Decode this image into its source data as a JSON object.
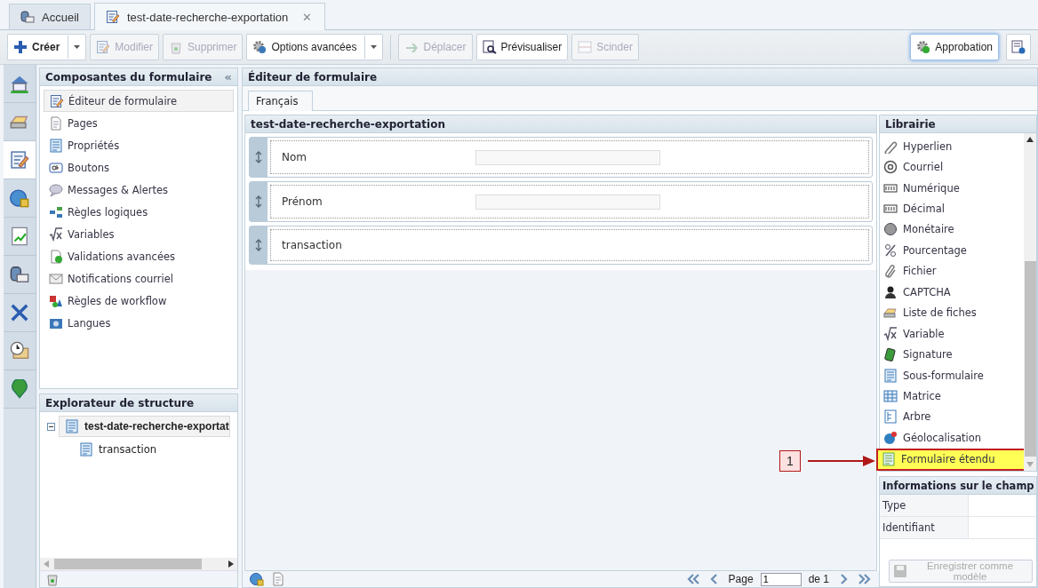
{
  "tabs": [
    {
      "label": "Accueil",
      "selected": false
    },
    {
      "label": "test-date-recherche-exportation",
      "selected": true,
      "close": "✕"
    }
  ],
  "toolbar": {
    "left": [
      {
        "label": "Créer",
        "disabled": false,
        "dropdown": true
      },
      {
        "label": "Modifier",
        "disabled": true,
        "dropdown": false
      },
      {
        "label": "Supprimer",
        "disabled": true,
        "dropdown": false
      },
      {
        "label": "Options avancées",
        "disabled": false,
        "dropdown": true
      },
      {
        "label": "Déplacer",
        "disabled": true,
        "dropdown": false
      },
      {
        "label": "Prévisualiser",
        "disabled": false,
        "dropdown": false
      },
      {
        "label": "Scinder",
        "disabled": true,
        "dropdown": false
      }
    ],
    "right": [
      {
        "label": "Approbation",
        "selected": true
      }
    ]
  },
  "rail": [
    {
      "selected": false
    },
    {
      "selected": false
    },
    {
      "selected": true
    },
    {
      "selected": false
    },
    {
      "selected": false
    },
    {
      "selected": false
    },
    {
      "selected": false
    },
    {
      "selected": false
    },
    {
      "selected": false
    }
  ],
  "components": {
    "title": "Composantes du formulaire",
    "collapse": "«",
    "items": [
      {
        "label": "Éditeur de formulaire",
        "selected": true
      },
      {
        "label": "Pages",
        "selected": false
      },
      {
        "label": "Propriétés",
        "selected": false
      },
      {
        "label": "Boutons",
        "selected": false
      },
      {
        "label": "Messages & Alertes",
        "selected": false
      },
      {
        "label": "Règles logiques",
        "selected": false
      },
      {
        "label": "Variables",
        "selected": false
      },
      {
        "label": "Validations avancées",
        "selected": false
      },
      {
        "label": "Notifications courriel",
        "selected": false
      },
      {
        "label": "Règles de workflow",
        "selected": false
      },
      {
        "label": "Langues",
        "selected": false
      }
    ]
  },
  "explorer": {
    "title": "Explorateur de structure",
    "tree": [
      {
        "label": "test-date-recherche-exportat",
        "expanded": true,
        "selected": true,
        "children": [
          {
            "label": "transaction"
          }
        ]
      }
    ]
  },
  "editor": {
    "title": "Éditeur de formulaire",
    "languages": [
      {
        "label": "Français",
        "selected": true
      }
    ],
    "form": {
      "title": "test-date-recherche-exportation",
      "fields": [
        {
          "kind": "text",
          "label": "Nom"
        },
        {
          "kind": "text",
          "label": "Prénom"
        },
        {
          "kind": "section",
          "label": "transaction"
        }
      ]
    },
    "pager": {
      "label": "Page",
      "value": "1",
      "total": "de 1"
    }
  },
  "library": {
    "title": "Librairie",
    "items": [
      {
        "label": "Hyperlien",
        "highlighted": false
      },
      {
        "label": "Courriel",
        "highlighted": false
      },
      {
        "label": "Numérique",
        "highlighted": false
      },
      {
        "label": "Décimal",
        "highlighted": false
      },
      {
        "label": "Monétaire",
        "highlighted": false
      },
      {
        "label": "Pourcentage",
        "highlighted": false
      },
      {
        "label": "Fichier",
        "highlighted": false
      },
      {
        "label": "CAPTCHA",
        "highlighted": false
      },
      {
        "label": "Liste de fiches",
        "highlighted": false
      },
      {
        "label": "Variable",
        "highlighted": false
      },
      {
        "label": "Signature",
        "highlighted": false
      },
      {
        "label": "Sous-formulaire",
        "highlighted": false
      },
      {
        "label": "Matrice",
        "highlighted": false
      },
      {
        "label": "Arbre",
        "highlighted": false
      },
      {
        "label": "Géolocalisation",
        "highlighted": false
      },
      {
        "label": "Formulaire étendu",
        "highlighted": true
      }
    ]
  },
  "field_info": {
    "title": "Informations sur le champ",
    "rows": [
      {
        "label": "Type"
      },
      {
        "label": "Identifiant"
      }
    ],
    "save_button": {
      "label": "Enregistrer comme modèle",
      "disabled": true
    }
  },
  "annotations": [
    {
      "label": "1"
    }
  ]
}
